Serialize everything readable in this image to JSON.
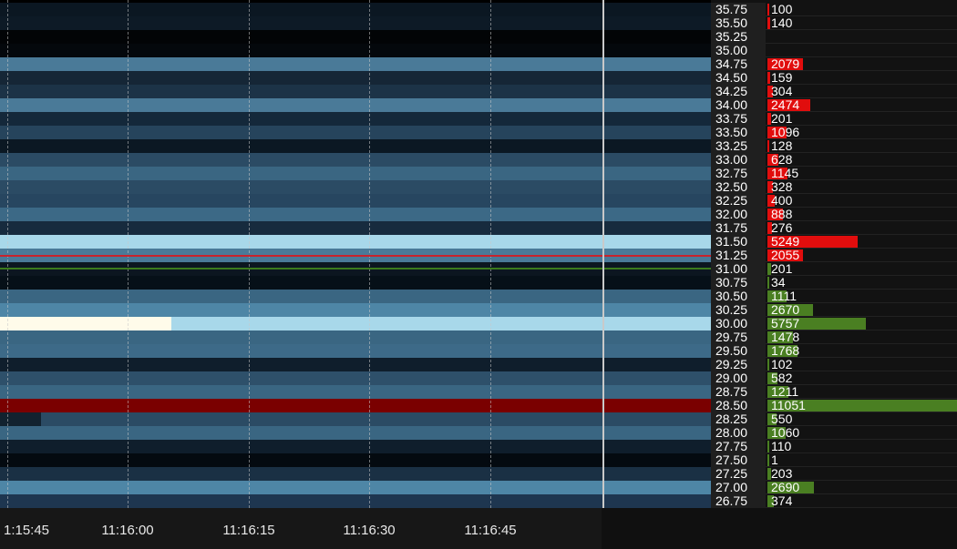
{
  "time_axis": {
    "ticks": [
      "1:15:45",
      "11:16:00",
      "11:16:15",
      "11:16:30",
      "11:16:45"
    ]
  },
  "colors": {
    "ask": "#e10d0d",
    "bid": "#4a7f22",
    "cursor": "#c9c9c9",
    "red_line": "#c8232c",
    "green_line": "#3b7a1c"
  },
  "ladder": [
    {
      "price": "35.75",
      "volume": "100",
      "side": "ask"
    },
    {
      "price": "35.50",
      "volume": "140",
      "side": "ask"
    },
    {
      "price": "35.25",
      "volume": "",
      "side": "none"
    },
    {
      "price": "35.00",
      "volume": "",
      "side": "none"
    },
    {
      "price": "34.75",
      "volume": "2079",
      "side": "ask"
    },
    {
      "price": "34.50",
      "volume": "159",
      "side": "ask"
    },
    {
      "price": "34.25",
      "volume": "304",
      "side": "ask"
    },
    {
      "price": "34.00",
      "volume": "2474",
      "side": "ask"
    },
    {
      "price": "33.75",
      "volume": "201",
      "side": "ask"
    },
    {
      "price": "33.50",
      "volume": "1096",
      "side": "ask"
    },
    {
      "price": "33.25",
      "volume": "128",
      "side": "ask"
    },
    {
      "price": "33.00",
      "volume": "628",
      "side": "ask"
    },
    {
      "price": "32.75",
      "volume": "1145",
      "side": "ask"
    },
    {
      "price": "32.50",
      "volume": "328",
      "side": "ask"
    },
    {
      "price": "32.25",
      "volume": "400",
      "side": "ask"
    },
    {
      "price": "32.00",
      "volume": "888",
      "side": "ask"
    },
    {
      "price": "31.75",
      "volume": "276",
      "side": "ask"
    },
    {
      "price": "31.50",
      "volume": "5249",
      "side": "ask"
    },
    {
      "price": "31.25",
      "volume": "2055",
      "side": "ask"
    },
    {
      "price": "31.00",
      "volume": "201",
      "side": "bid"
    },
    {
      "price": "30.75",
      "volume": "34",
      "side": "bid"
    },
    {
      "price": "30.50",
      "volume": "1111",
      "side": "bid"
    },
    {
      "price": "30.25",
      "volume": "2670",
      "side": "bid"
    },
    {
      "price": "30.00",
      "volume": "5757",
      "side": "bid"
    },
    {
      "price": "29.75",
      "volume": "1478",
      "side": "bid"
    },
    {
      "price": "29.50",
      "volume": "1768",
      "side": "bid"
    },
    {
      "price": "29.25",
      "volume": "102",
      "side": "bid"
    },
    {
      "price": "29.00",
      "volume": "582",
      "side": "bid"
    },
    {
      "price": "28.75",
      "volume": "1211",
      "side": "bid"
    },
    {
      "price": "28.50",
      "volume": "11051",
      "side": "bid"
    },
    {
      "price": "28.25",
      "volume": "550",
      "side": "bid"
    },
    {
      "price": "28.00",
      "volume": "1060",
      "side": "bid"
    },
    {
      "price": "27.75",
      "volume": "110",
      "side": "bid"
    },
    {
      "price": "27.50",
      "volume": "1",
      "side": "bid"
    },
    {
      "price": "27.25",
      "volume": "203",
      "side": "bid"
    },
    {
      "price": "27.00",
      "volume": "2690",
      "side": "bid"
    },
    {
      "price": "26.75",
      "volume": "374",
      "side": "bid"
    }
  ],
  "heatmap": [
    "#0b1722",
    "#0d1a26",
    "#020406",
    "#04080c",
    "#4a7a98",
    "#152636",
    "#1c3347",
    "#4a7a98",
    "#14283a",
    "#26445c",
    "#0b1823",
    "#2b4b64",
    "#3a6682",
    "#2b4b64",
    "#274660",
    "#3c6986",
    "#172b3e",
    "#a8d8ea",
    "#4a7a98",
    "#0c1620",
    "#061018",
    "#3a6682",
    "#4e86a6",
    "#a8d8ea",
    "#3a6682",
    "#3d6a88",
    "#0f1e2c",
    "#2e506a",
    "#3a6682",
    "#7a0000",
    "#2b4b64",
    "#3a6682",
    "#0f1e2c",
    "#040a10",
    "#1a3044",
    "#4e86a6",
    "#1e3650"
  ]
}
